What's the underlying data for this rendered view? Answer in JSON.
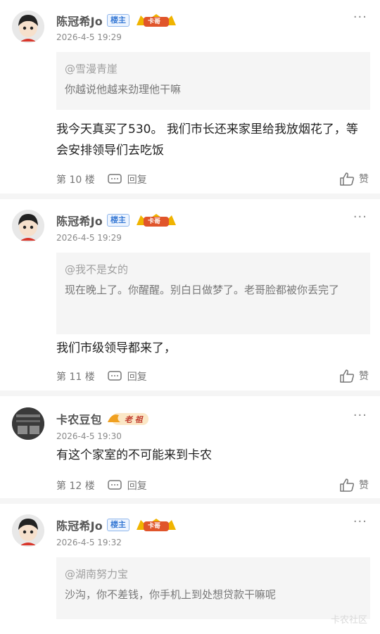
{
  "posts": [
    {
      "author": "陈冠希Jo",
      "host_badge": "楼主",
      "title_badge": "卡哥",
      "date": "2026-4-5 19:29",
      "quote": {
        "name": "@雪漫青崖",
        "text": "你越说他越来劲理他干嘛"
      },
      "content": "我今天真买了530。 我们市长还来家里给我放烟花了，等会安排领导们去吃饭",
      "floor": "第 10 楼",
      "reply_label": "回复",
      "like_label": "赞"
    },
    {
      "author": "陈冠希Jo",
      "host_badge": "楼主",
      "title_badge": "卡哥",
      "date": "2026-4-5 19:29",
      "quote": {
        "name": "@我不是女的",
        "text": "现在晚上了。你醒醒。别白日做梦了。老哥脸都被你丢完了"
      },
      "content": "我们市级领导都来了，",
      "floor": "第 11 楼",
      "reply_label": "回复",
      "like_label": "赞"
    },
    {
      "author": "卡农豆包",
      "title_badge": "老 祖",
      "date": "2026-4-5 19:30",
      "content": "有这个家室的不可能来到卡农",
      "floor": "第 12 楼",
      "reply_label": "回复",
      "like_label": "赞"
    },
    {
      "author": "陈冠希Jo",
      "host_badge": "楼主",
      "title_badge": "卡哥",
      "date": "2026-4-5 19:32",
      "quote": {
        "name": "@湖南努力宝",
        "text": "沙沟，你不差钱，你手机上到处想贷款干嘛呢"
      }
    }
  ],
  "more_icon": "more-dots-icon",
  "watermark": "卡农社区",
  "colors": {
    "host_badge": "#3a7bd5",
    "quote_bg": "#f5f5f5",
    "crown": "#f0b400"
  }
}
